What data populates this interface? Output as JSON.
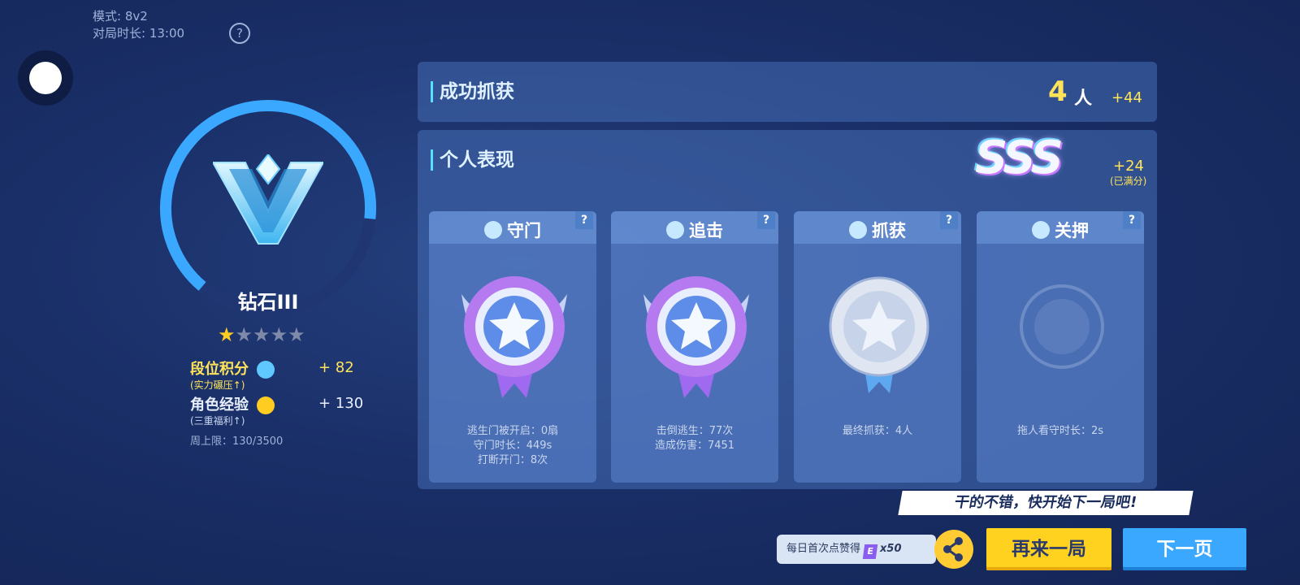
{
  "match": {
    "mode": "模式: 8v2",
    "duration": "对局时长: 13:00",
    "help": "?"
  },
  "rank": {
    "name": "钻石III",
    "stars_filled": 1,
    "stars_total": 5,
    "rank_points_label": "段位积分",
    "rank_points_sub": "(实力碾压↑)",
    "rank_points_value": "+ 82",
    "exp_label": "角色经验",
    "exp_sub": "(三重福利↑)",
    "exp_value": "+ 130",
    "weekly_cap": "周上限：130/3500",
    "progress": 0.6
  },
  "capture": {
    "title": "成功抓获",
    "count": "4",
    "unit": "人",
    "bonus": "+44"
  },
  "performance": {
    "title": "个人表现",
    "grade": "SSS",
    "bonus": "+24",
    "note": "(已满分)"
  },
  "cards": [
    {
      "title": "守门",
      "q": "?",
      "stats": [
        "逃生门被开启：0扇",
        "守门时长：449s",
        "打断开门：8次"
      ],
      "medal": "star-medal-purple"
    },
    {
      "title": "追击",
      "q": "?",
      "stats": [
        "击倒逃生：77次",
        "造成伤害：7451"
      ],
      "medal": "star-medal-purple"
    },
    {
      "title": "抓获",
      "q": "?",
      "stats": [
        "最终抓获：4人"
      ],
      "medal": "star-medal-silver"
    },
    {
      "title": "关押",
      "q": "?",
      "stats": [
        "拖人看守时长：2s"
      ],
      "medal": "empty-medal"
    }
  ],
  "bottom": {
    "praise": "干的不错，快开始下一局吧!",
    "daily_text": "每日首次点赞得",
    "daily_badge": "E",
    "daily_amount": "x50",
    "again": "再来一局",
    "next": "下一页"
  },
  "colors": {
    "accent_yellow": "#ffe45a",
    "accent_cyan": "#59e0ff",
    "button_blue": "#3aa8ff",
    "button_yellow": "#ffd21f"
  }
}
